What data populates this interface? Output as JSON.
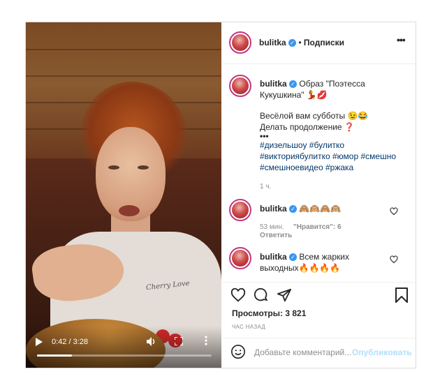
{
  "video": {
    "shirt_text": "Cherry Love",
    "time": "0:42 / 3:28",
    "progress": 0.2
  },
  "header": {
    "username": "bulitka",
    "bullet": "•",
    "follow_label": "Подписки",
    "more_icon": "•••"
  },
  "caption": {
    "username": "bulitka",
    "line1": "Образ \"Поэтесса",
    "line2": "Кукушкина\" 💃💋",
    "line3": "Весёлой вам субботы 😉😂",
    "line4": "Делать продолжение ❓",
    "dots": "•••",
    "tags": [
      "#дизельшоу",
      "#булитко",
      "#викториябулитко",
      "#юмор",
      "#смешно",
      "#смешноевидео",
      "#ржака"
    ],
    "time": "1 ч."
  },
  "comments": [
    {
      "username": "bulitka",
      "text": "🙈🙉🙈🙉",
      "time": "53 мин.",
      "likes": "\"Нравится\": 6",
      "reply": "Ответить"
    },
    {
      "username": "bulitka",
      "text_line1": "Всем жарких",
      "text_line2": "выходных🔥🔥🔥🔥"
    }
  ],
  "actions": {
    "views": "Просмотры: 3 821",
    "posted": "ЧАС НАЗАД"
  },
  "comment_box": {
    "placeholder": "Добавьте комментарий...",
    "publish": "Опубликовать"
  },
  "colors": {
    "accent": "#c13584",
    "verified": "#3897f0",
    "tag": "#00376b",
    "publish": "#b2dffc"
  }
}
